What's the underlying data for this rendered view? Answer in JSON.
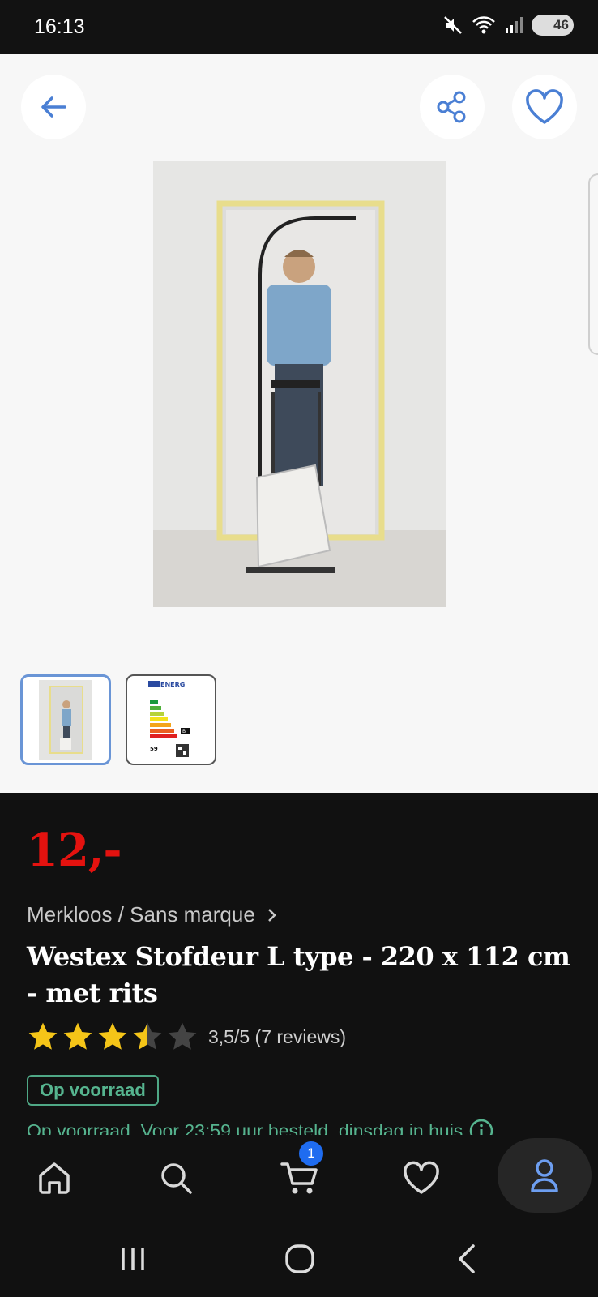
{
  "status_bar": {
    "time": "16:13",
    "battery": "46"
  },
  "product": {
    "price": "12,-",
    "brand": "Merkloos / Sans marque",
    "title": "Westex Stofdeur  L type - 220 x 112 cm - met rits",
    "rating_value": 3.5,
    "rating_text": "3,5/5 (7 reviews)",
    "stock_badge": "Op voorraad",
    "delivery_text": "Op voorraad. Voor 23:59 uur besteld, dinsdag in huis"
  },
  "energy_label": {
    "header": "ENERG",
    "class": "B",
    "number": "59"
  },
  "thumbnails": [
    {
      "name": "product-photo",
      "active": true
    },
    {
      "name": "energy-label",
      "active": false
    }
  ],
  "bottom_nav": {
    "cart_count": "1"
  },
  "icons": [
    "back-arrow-icon",
    "share-icon",
    "heart-icon",
    "home-icon",
    "search-icon",
    "cart-icon",
    "heart-icon",
    "user-icon",
    "mute-icon",
    "wifi-icon",
    "signal-icon",
    "info-icon"
  ],
  "colors": {
    "price": "#e4120f",
    "accent_blue": "#4a7fd4",
    "stock_green": "#56b48f",
    "badge_blue": "#1f6cf0"
  }
}
